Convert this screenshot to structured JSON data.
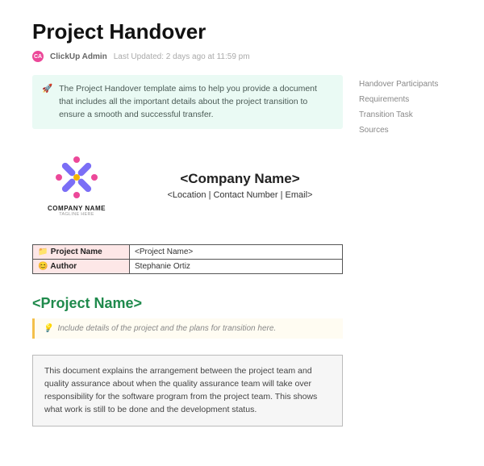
{
  "title": "Project Handover",
  "meta": {
    "avatar_initials": "CA",
    "author": "ClickUp Admin",
    "updated": "Last Updated: 2 days ago at 11:59 pm"
  },
  "callout": {
    "emoji": "🚀",
    "text": "The Project Handover template aims to help you provide a document that includes all the important details about the project transition to ensure a smooth and successful transfer."
  },
  "toc": [
    "Handover Participants",
    "Requirements",
    "Transition Task",
    "Sources"
  ],
  "logo": {
    "name": "COMPANY NAME",
    "tagline": "TAGLINE HERE"
  },
  "company": {
    "name": "<Company Name>",
    "sub": "<Location | Contact Number | Email>"
  },
  "info_rows": [
    {
      "emoji": "📁",
      "label": "Project Name",
      "value": "<Project Name>"
    },
    {
      "emoji": "😊",
      "label": "Author",
      "value": "Stephanie Ortiz"
    }
  ],
  "section_heading": "<Project Name>",
  "hint": {
    "emoji": "💡",
    "text": "Include details of the project and the plans for transition here."
  },
  "description": "This document explains the arrangement between the project team and quality assurance about when the quality assurance team will take over responsibility for the software program from the project team. This shows what work is still to be done and the development status."
}
